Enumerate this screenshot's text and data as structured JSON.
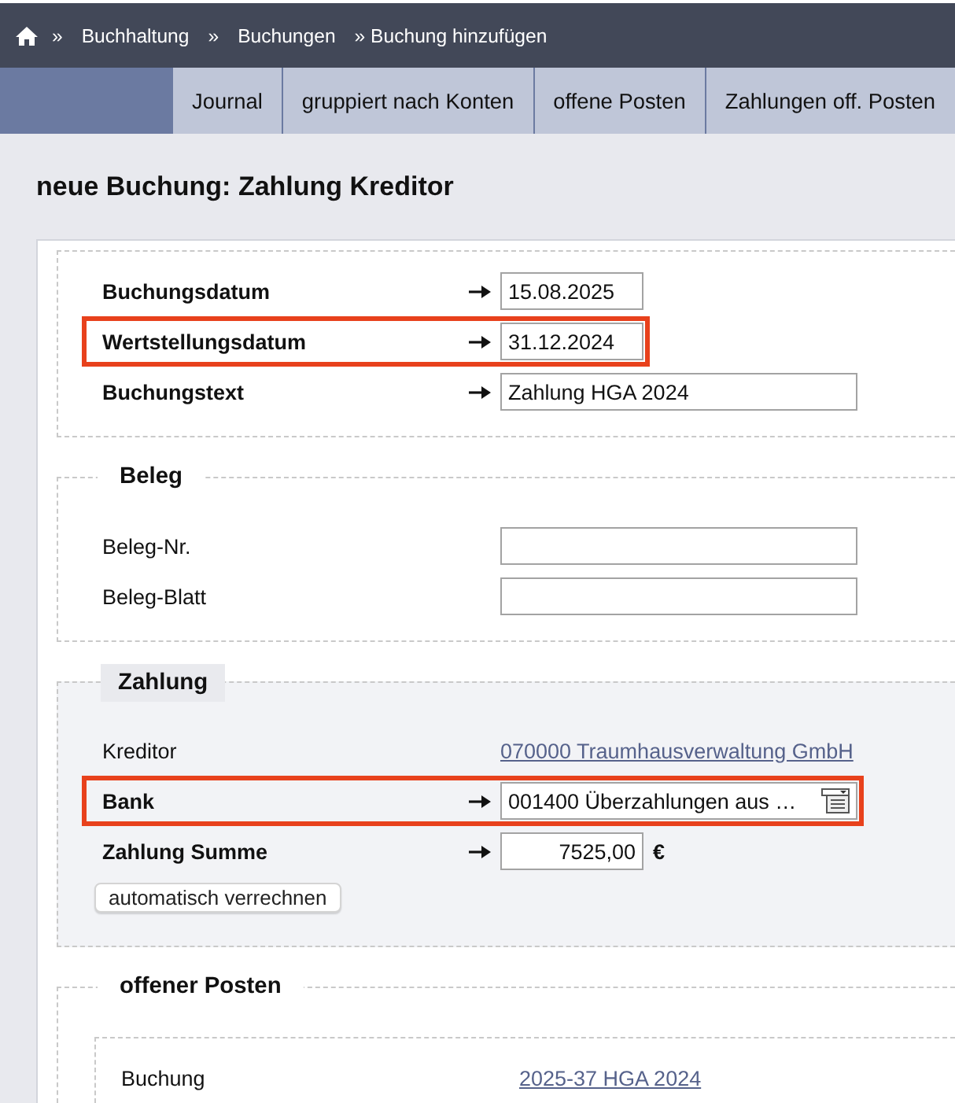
{
  "breadcrumb": {
    "items": [
      {
        "separator": "»",
        "label": "Buchhaltung"
      },
      {
        "separator": "»",
        "label": "Buchungen"
      }
    ],
    "current": "» Buchung hinzufügen"
  },
  "tabs": [
    {
      "label": "Journal",
      "selected": false
    },
    {
      "label": "gruppiert nach Konten",
      "selected": false
    },
    {
      "label": "offene Posten",
      "selected": false
    },
    {
      "label": "Zahlungen off. Posten",
      "selected": false
    }
  ],
  "title": "neue Buchung: Zahlung Kreditor",
  "sections": [
    {
      "kind": "plain",
      "fields": [
        {
          "label": "Buchungsdatum",
          "kind": "date",
          "required": true,
          "highlighted": false,
          "value": "15.08.2025"
        },
        {
          "label": "Wertstellungsdatum",
          "kind": "date",
          "required": true,
          "highlighted": true,
          "value": "31.12.2024"
        },
        {
          "label": "Buchungstext",
          "kind": "text",
          "required": true,
          "highlighted": false,
          "value": "Zahlung HGA 2024"
        }
      ]
    },
    {
      "kind": "plain",
      "legend": "Beleg",
      "fields": [
        {
          "label": "Beleg-Nr.",
          "kind": "text",
          "required": false,
          "highlighted": false
        },
        {
          "label": "Beleg-Blatt",
          "kind": "text",
          "required": false,
          "highlighted": false
        }
      ]
    },
    {
      "kind": "shaded",
      "legend": "Zahlung",
      "fields": [
        {
          "label": "Kreditor",
          "kind": "link",
          "required": false,
          "highlighted": false,
          "value": "070000 Traumhausverwaltung GmbH"
        },
        {
          "label": "Bank",
          "kind": "select",
          "required": true,
          "highlighted": true,
          "value": "001400 Überzahlungen aus …"
        },
        {
          "label": "Zahlung Summe",
          "kind": "amount",
          "required": true,
          "highlighted": false,
          "value": "7525,00",
          "unit": "€"
        }
      ],
      "buttons": [
        "automatisch verrechnen"
      ]
    },
    {
      "kind": "nested",
      "legend": "offener Posten",
      "fields": [
        {
          "label": "Buchung",
          "kind": "link",
          "required": false,
          "highlighted": false,
          "value": "2025-37 HGA 2024"
        }
      ]
    }
  ]
}
